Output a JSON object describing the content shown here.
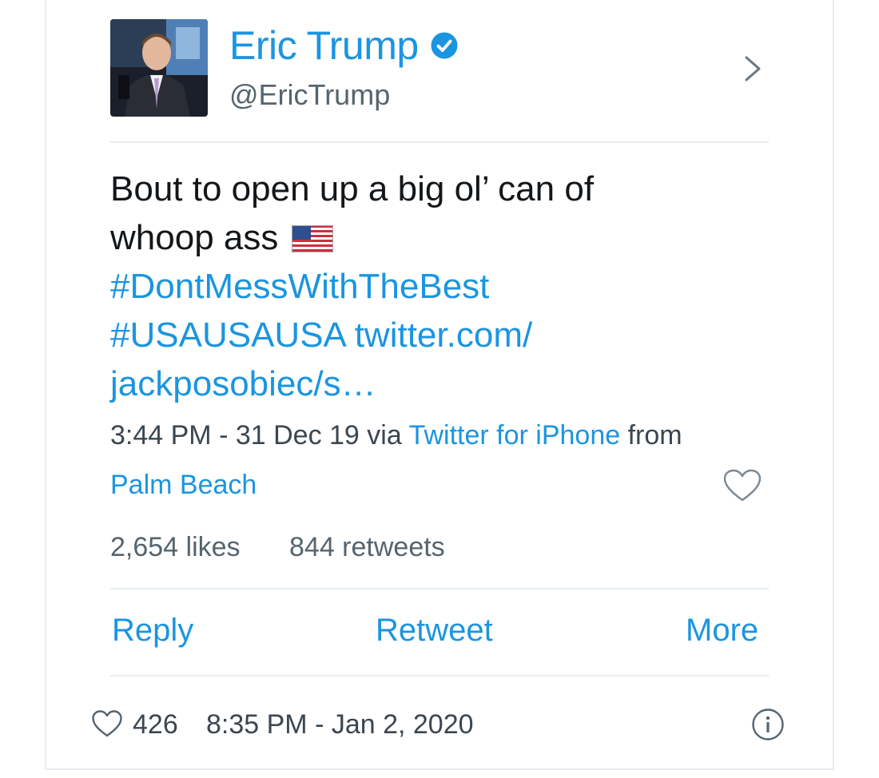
{
  "author": {
    "name": "Eric Trump",
    "handle": "@EricTrump",
    "verified": true
  },
  "tweet": {
    "text_line1": "Bout to open up a big ol’ can of",
    "text_line2": "whoop ass",
    "flag_emoji": "us-flag-icon",
    "hashtag1": "#DontMessWithTheBest",
    "hashtag2": "#USAUSAUSA",
    "link_part1": "twitter.com/",
    "link_part2": "jackposobiec/s…"
  },
  "meta": {
    "time": "3:44 PM - 31 Dec 19",
    "via_label": "via",
    "client": "Twitter for iPhone",
    "from_label": "from",
    "place": "Palm Beach"
  },
  "stats": {
    "likes": "2,654 likes",
    "retweets": "844 retweets"
  },
  "actions": {
    "reply": "Reply",
    "retweet": "Retweet",
    "more": "More"
  },
  "footer": {
    "like_count": "426",
    "timestamp": "8:35 PM - Jan 2, 2020"
  },
  "colors": {
    "accent": "#1b95e0",
    "text": "#14171a",
    "muted": "#55646e",
    "divider": "#e6ecf0"
  }
}
